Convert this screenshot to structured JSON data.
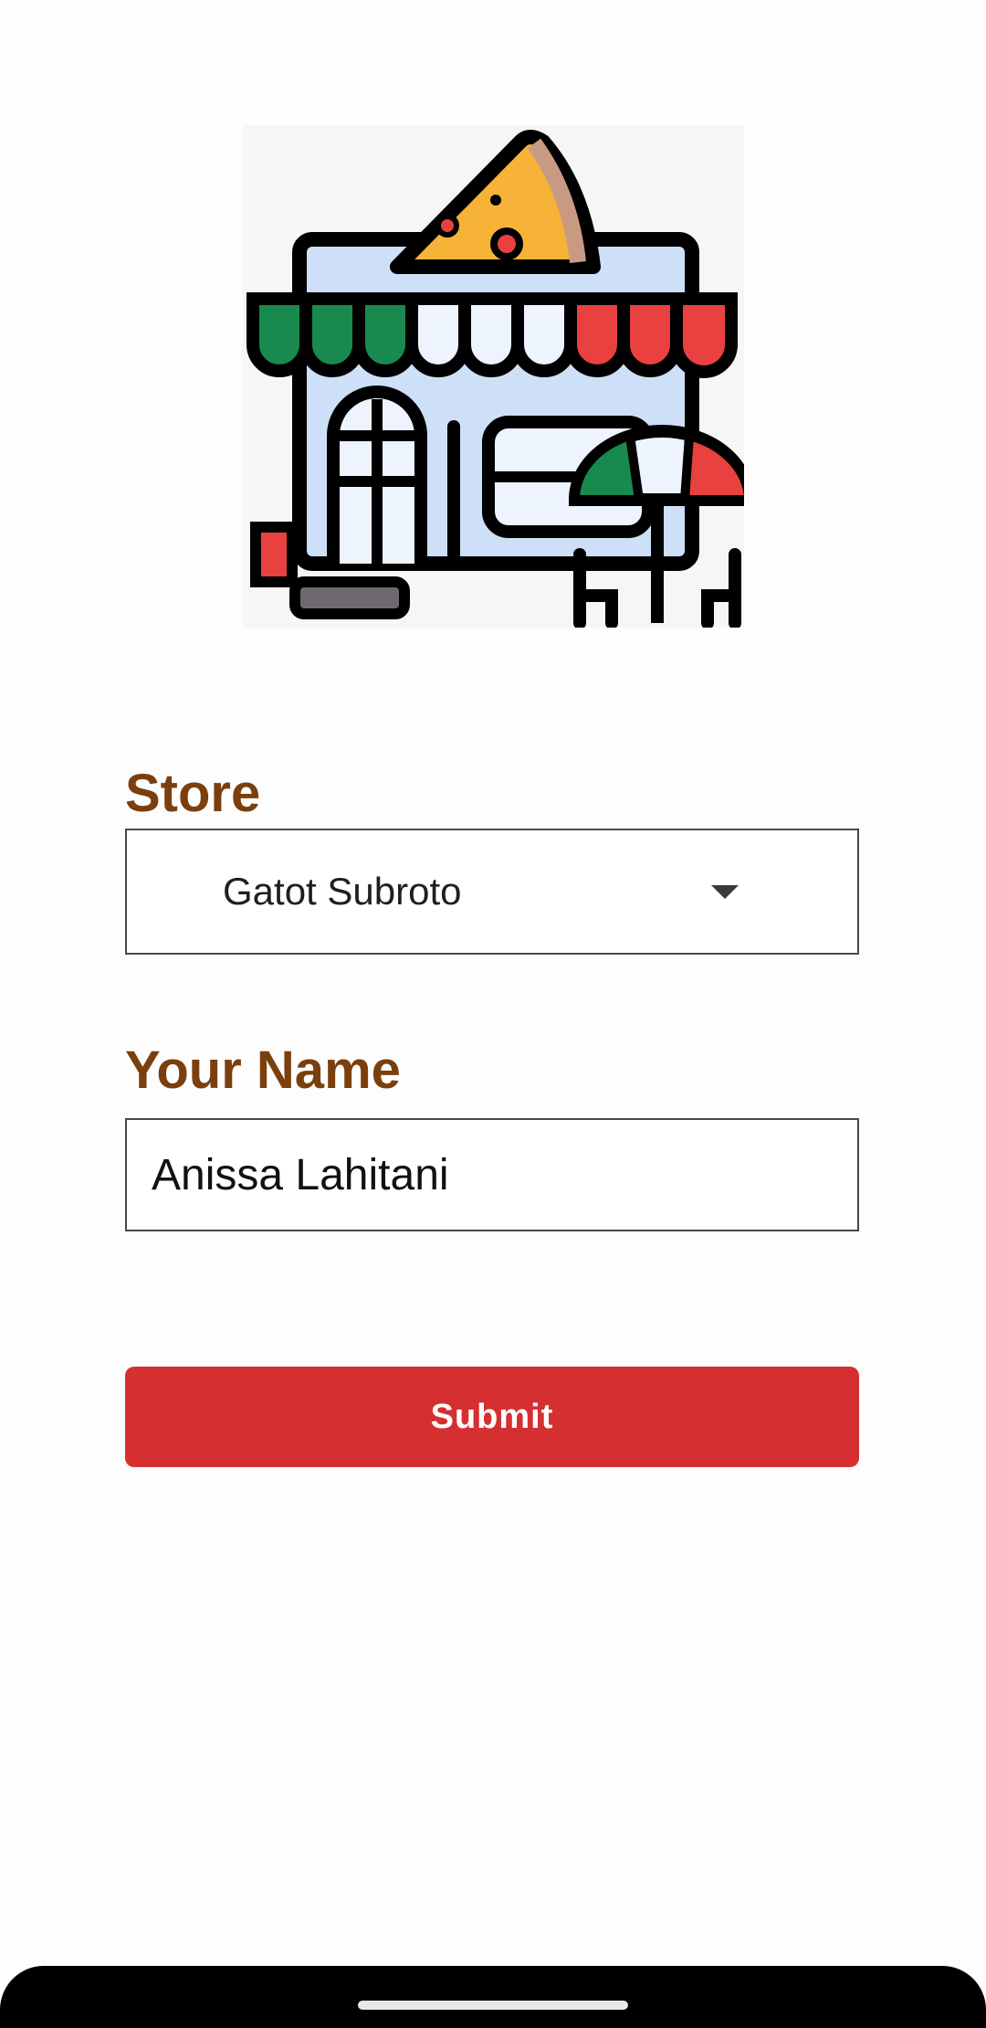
{
  "logo": {
    "icon": "pizza-store-icon"
  },
  "store": {
    "label": "Store",
    "selected": "Gatot Subroto"
  },
  "name": {
    "label": "Your Name",
    "value": "Anissa Lahitani"
  },
  "submit": {
    "label": "Submit"
  },
  "colors": {
    "label": "#7b3f0e",
    "button": "#d62f32",
    "green": "#198a4f",
    "red": "#e8413f",
    "blue": "#cde0f8",
    "cheese": "#f7b238"
  }
}
